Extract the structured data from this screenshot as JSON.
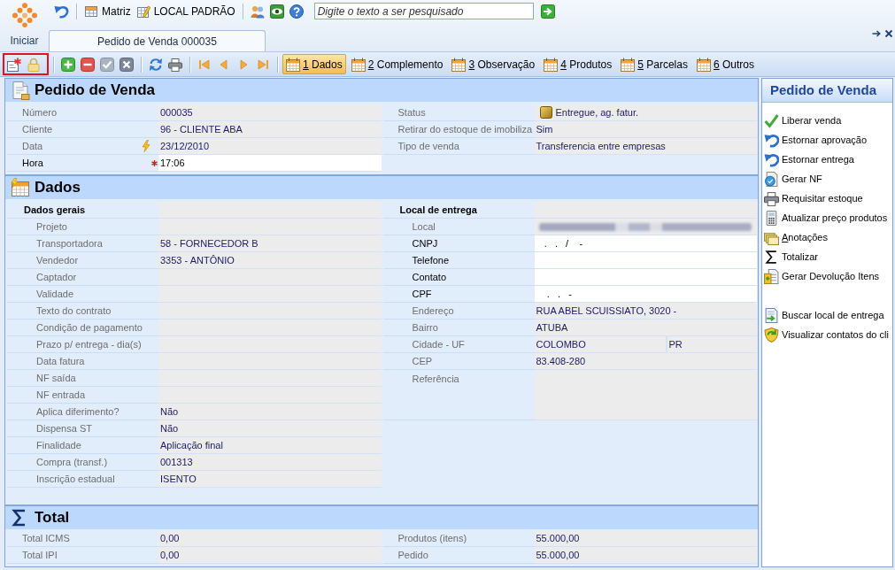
{
  "start_button": {
    "label": "Iniciar"
  },
  "quick_toolbar": {
    "buttons": [
      {
        "label": "Matriz"
      },
      {
        "label": "LOCAL PADRÃO"
      }
    ],
    "search": {
      "placeholder": "Digite o texto a ser pesquisado"
    }
  },
  "document_tabs": [
    {
      "label": "Pedido de Venda 000035"
    }
  ],
  "record_toolbar": {
    "tabs": [
      {
        "number": "1",
        "label": "Dados",
        "selected": true
      },
      {
        "number": "2",
        "label": "Complemento",
        "selected": false
      },
      {
        "number": "3",
        "label": "Observação",
        "selected": false
      },
      {
        "number": "4",
        "label": "Produtos",
        "selected": false
      },
      {
        "number": "5",
        "label": "Parcelas",
        "selected": false
      },
      {
        "number": "6",
        "label": "Outros",
        "selected": false
      }
    ]
  },
  "form": {
    "sections": [
      {
        "kind": "header",
        "title": "Pedido de Venda",
        "columns": [
          {
            "fields": [
              {
                "kind": "text",
                "label": "Número",
                "value": "000035",
                "required": false
              },
              {
                "kind": "text",
                "label": "Cliente",
                "value": "96 - CLIENTE ABA",
                "required": false
              },
              {
                "kind": "date",
                "label": "Data",
                "value": "23/12/2010",
                "required": false
              },
              {
                "kind": "input",
                "label": "Hora",
                "value": "17:06",
                "required": true
              }
            ]
          },
          {
            "fields": [
              {
                "kind": "status",
                "label": "Status",
                "value": "Entregue, ag. fatur."
              },
              {
                "kind": "text",
                "label": "Retirar do estoque de imobiliza",
                "value": "Sim"
              },
              {
                "kind": "text",
                "label": "Tipo de venda",
                "value": "Transferencia entre empresas"
              }
            ]
          }
        ]
      },
      {
        "kind": "details",
        "title": "Dados",
        "columns": [
          {
            "group": "Dados gerais",
            "fields": [
              {
                "kind": "text",
                "label": "Projeto"
              },
              {
                "kind": "text",
                "label": "Transportadora",
                "value": "58 - FORNECEDOR B"
              },
              {
                "kind": "text",
                "label": "Vendedor",
                "value": "3353 - ANTÔNIO"
              },
              {
                "kind": "text",
                "label": "Captador"
              },
              {
                "kind": "text",
                "label": "Validade"
              },
              {
                "kind": "text",
                "label": "Texto do contrato"
              },
              {
                "kind": "text",
                "label": "Condição de pagamento"
              },
              {
                "kind": "text",
                "label": "Prazo p/ entrega - dia(s)"
              },
              {
                "kind": "text",
                "label": "Data fatura"
              },
              {
                "kind": "text",
                "label": "NF saída"
              },
              {
                "kind": "text",
                "label": "NF entrada"
              },
              {
                "kind": "text",
                "label": "Aplica diferimento?",
                "value": "Não"
              },
              {
                "kind": "text",
                "label": "Dispensa ST",
                "value": "Não"
              },
              {
                "kind": "text",
                "label": "Finalidade",
                "value": "Aplicação final"
              },
              {
                "kind": "text",
                "label": "Compra (transf.)",
                "value": "001313"
              },
              {
                "kind": "text",
                "label": "Inscrição estadual",
                "value": "ISENTO"
              }
            ]
          },
          {
            "group": "Local de entrega",
            "fields": [
              {
                "kind": "redacted",
                "label": "Local"
              },
              {
                "kind": "input",
                "label": "CNPJ",
                "value": "   .   .   /    -"
              },
              {
                "kind": "input",
                "label": "Telefone"
              },
              {
                "kind": "input",
                "label": "Contato"
              },
              {
                "kind": "input",
                "label": "CPF",
                "value": "    .   .   -"
              },
              {
                "kind": "text",
                "label": "Endereço",
                "value": "RUA ABEL SCUISSIATO, 3020 -"
              },
              {
                "kind": "text",
                "label": "Bairro",
                "value": "ATUBA"
              },
              {
                "kind": "split",
                "label": "Cidade - UF",
                "values": [
                  "COLOMBO",
                  "PR"
                ]
              },
              {
                "kind": "text",
                "label": "CEP",
                "value": "83.408-280"
              },
              {
                "kind": "memo",
                "label": "Referência"
              }
            ]
          }
        ]
      },
      {
        "kind": "totals",
        "title": "Total",
        "columns": [
          {
            "fields": [
              {
                "kind": "text",
                "label": "Total ICMS",
                "value": "0,00"
              },
              {
                "kind": "text",
                "label": "Total IPI",
                "value": "0,00"
              }
            ]
          },
          {
            "fields": [
              {
                "kind": "text",
                "label": "Produtos (itens)",
                "value": "55.000,00"
              },
              {
                "kind": "text",
                "label": "Pedido",
                "value": "55.000,00"
              }
            ]
          }
        ]
      }
    ]
  },
  "action_panel": {
    "title": "Pedido de Venda",
    "groups": [
      [
        {
          "label": "Liberar venda",
          "accelerator": false
        },
        {
          "label": "Estornar aprovação",
          "accelerator": false
        },
        {
          "label": "Estornar entrega",
          "accelerator": false
        },
        {
          "label": "Gerar NF",
          "accelerator": false
        },
        {
          "label": "Requisitar estoque",
          "accelerator": false
        },
        {
          "label": "Atualizar preço produtos",
          "accelerator": false
        },
        {
          "label": "Anotações",
          "accelerator": true
        },
        {
          "label": "Totalizar",
          "accelerator": false
        },
        {
          "label": "Gerar Devolução Itens",
          "accelerator": false
        }
      ],
      [
        {
          "label": "Buscar local de entrega",
          "accelerator": false
        },
        {
          "label": "Visualizar contatos do cli",
          "accelerator": false
        }
      ]
    ]
  }
}
